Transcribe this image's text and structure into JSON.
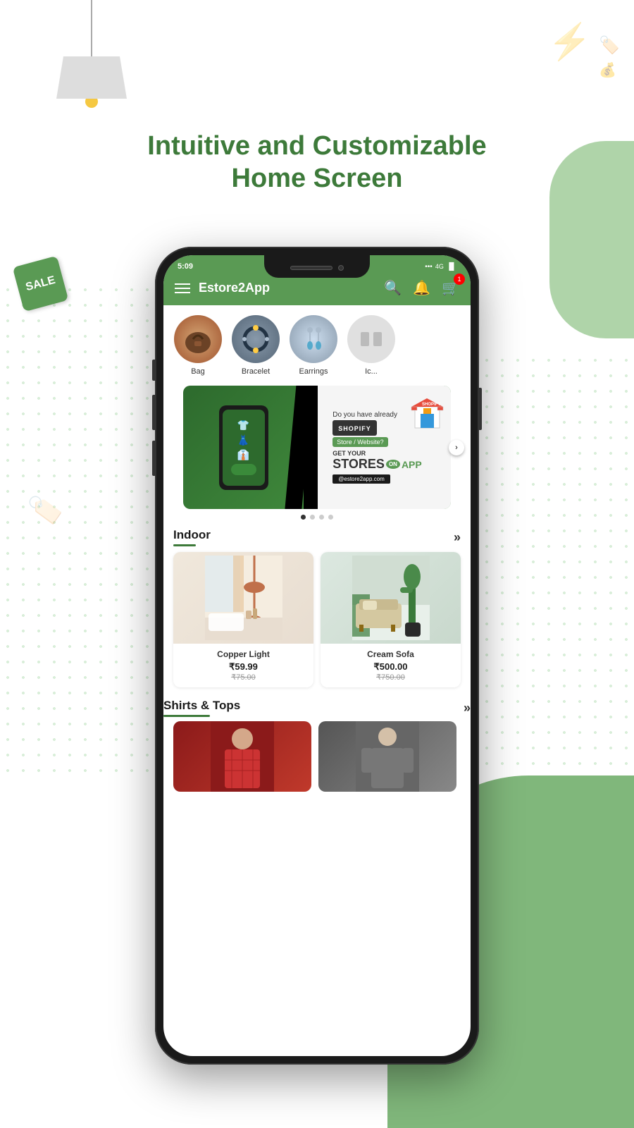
{
  "page": {
    "heading_line1": "Intuitive and Customizable",
    "heading_line2": "Home Screen"
  },
  "app": {
    "title": "Estore2App",
    "status_time": "5:09",
    "status_dots": "•••",
    "cart_badge": "1"
  },
  "categories": [
    {
      "id": "bag",
      "label": "Bag",
      "emoji": "👜"
    },
    {
      "id": "bracelet",
      "label": "Bracelet",
      "emoji": "📿"
    },
    {
      "id": "earrings",
      "label": "Earrings",
      "emoji": "💎"
    },
    {
      "id": "partial",
      "label": "...",
      "emoji": "🛍️"
    }
  ],
  "banner": {
    "line1": "Do you have already",
    "brand": "SHOPIFY",
    "store_label": "Store / Website?",
    "get": "GET YOUR",
    "stores": "STORES",
    "on": "ON",
    "app": "APP",
    "url": "@estore2app.com"
  },
  "sections": [
    {
      "id": "indoor",
      "title": "Indoor",
      "more_label": "»",
      "products": [
        {
          "id": "copper-light",
          "name": "Copper Light",
          "price": "₹59.99",
          "original_price": "₹75.00",
          "emoji": "💡"
        },
        {
          "id": "cream-sofa",
          "name": "Cream Sofa",
          "price": "₹500.00",
          "original_price": "₹750.00",
          "emoji": "🛋️"
        }
      ]
    },
    {
      "id": "shirts-tops",
      "title": "Shirts & Tops",
      "more_label": "»"
    }
  ],
  "colors": {
    "primary_green": "#5a9a54",
    "dark_green": "#3d7a3a",
    "accent_green": "#6aaa64",
    "light_green_dots": "#c8e6c9"
  }
}
